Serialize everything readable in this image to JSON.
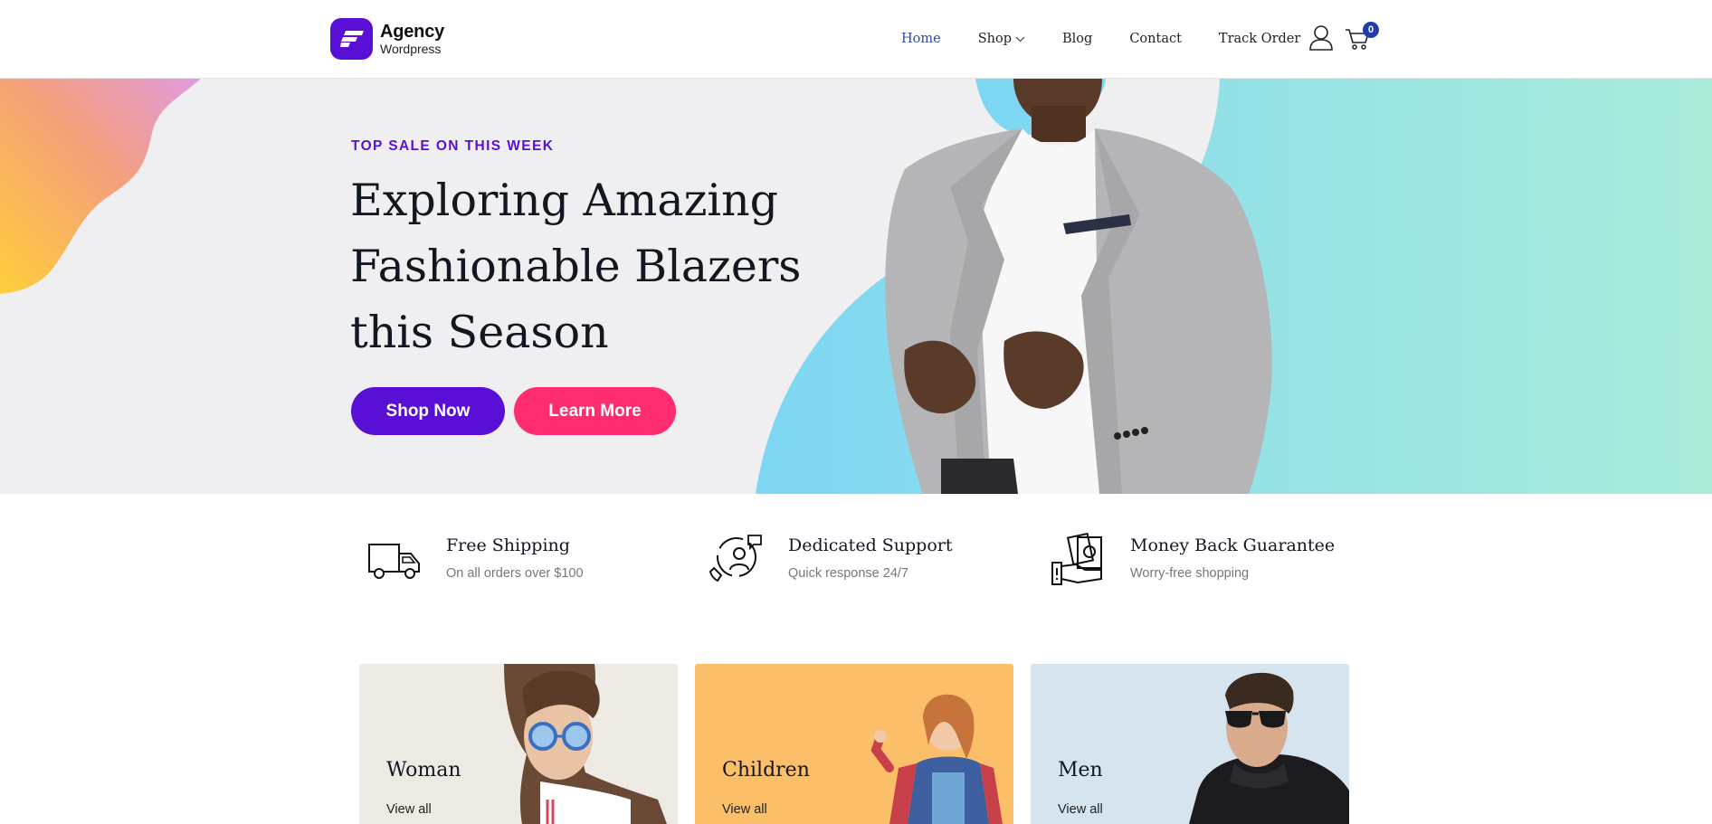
{
  "logo": {
    "name": "Agency",
    "subtitle": "Wordpress"
  },
  "nav": {
    "items": [
      {
        "label": "Home",
        "active": true
      },
      {
        "label": "Shop",
        "active": false,
        "has_dropdown": true
      },
      {
        "label": "Blog",
        "active": false
      },
      {
        "label": "Contact",
        "active": false
      },
      {
        "label": "Track Order",
        "active": false
      }
    ],
    "icons": [
      "user-icon",
      "cart-icon"
    ],
    "cart_count": "0"
  },
  "hero": {
    "eyebrow": "TOP SALE ON THIS WEEK",
    "title_lines": [
      "Exploring Amazing",
      "Fashionable Blazers",
      "this Season"
    ],
    "primary_button": "Shop Now",
    "secondary_button": "Learn More"
  },
  "features": [
    {
      "icon": "truck-icon",
      "title": "Free Shipping",
      "desc": "On all orders over $100"
    },
    {
      "icon": "support-icon",
      "title": "Dedicated Support",
      "desc": "Quick response 24/7"
    },
    {
      "icon": "money-back-icon",
      "title": "Money Back Guarantee",
      "desc": "Worry-free shopping"
    }
  ],
  "categories": [
    {
      "title": "Woman",
      "link": "View all"
    },
    {
      "title": "Children",
      "link": "View all"
    },
    {
      "title": "Men",
      "link": "View all"
    }
  ],
  "colors": {
    "brand": "#5a0fd6",
    "accent": "#ff2d6f",
    "nav_active": "#2b4aa8",
    "hero_bg": "#efeff1"
  }
}
